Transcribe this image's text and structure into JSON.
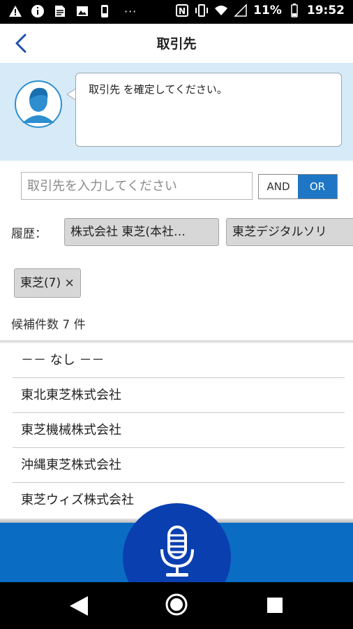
{
  "status_bar": {
    "battery": "11%",
    "time": "19:52",
    "dots": "···"
  },
  "header": {
    "title": "取引先"
  },
  "assistant": {
    "message": "取引先 を確定してください。"
  },
  "search": {
    "placeholder": "取引先を入力してください",
    "value": ""
  },
  "match_mode": {
    "and_label": "AND",
    "or_label": "OR",
    "selected": "OR"
  },
  "history": {
    "label": "履歴：",
    "items": [
      "株式会社 東芝(本社…",
      "東芝デジタルソリ"
    ]
  },
  "filter": {
    "chip": "東芝(7) ×"
  },
  "results": {
    "count_text": "候補件数 7 件",
    "items": [
      "－－ なし －－",
      "東北東芝株式会社",
      "東芝機械株式会社",
      "沖縄東芝株式会社",
      "東芝ウィズ株式会社"
    ]
  },
  "colors": {
    "accent": "#1e76c4",
    "bottom_bar": "#0a6cc2",
    "mic_button": "#0a3fb0",
    "assistant_bg": "#d6ebf7"
  },
  "icons": {
    "back": "chevron-left-icon",
    "avatar": "assistant-avatar-icon",
    "mic": "microphone-icon"
  }
}
